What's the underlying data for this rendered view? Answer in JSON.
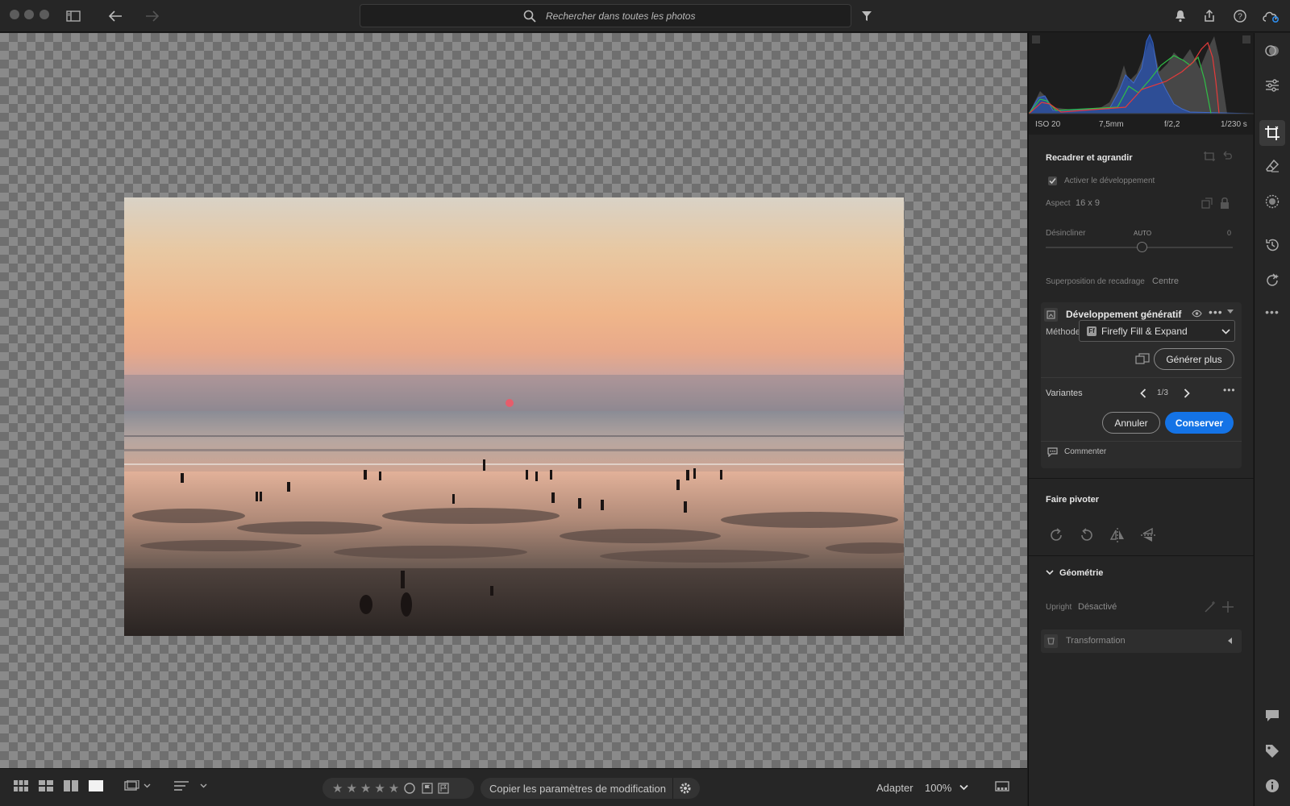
{
  "topbar": {
    "search_placeholder": "Rechercher dans toutes les photos"
  },
  "histogram": {
    "iso": "ISO 20",
    "focal": "7,5mm",
    "aperture": "f/2,2",
    "shutter": "1/230 s"
  },
  "crop": {
    "title": "Recadrer et agrandir",
    "enable_expand_label": "Activer le développement",
    "enable_expand_checked": true,
    "aspect_label": "Aspect",
    "aspect_value": "16 x 9",
    "straighten_label": "Désincliner",
    "straighten_auto": "AUTO",
    "straighten_value": "0",
    "overlay_label": "Superposition de recadrage",
    "overlay_value": "Centre"
  },
  "generative": {
    "title": "Développement génératif",
    "method_label": "Méthode",
    "method_value": "Firefly Fill & Expand",
    "generate_more": "Générer plus",
    "variants_label": "Variantes",
    "variants_counter": "1/3",
    "cancel": "Annuler",
    "keep": "Conserver",
    "comment": "Commenter"
  },
  "rotate": {
    "title": "Faire pivoter"
  },
  "geometry": {
    "title": "Géométrie",
    "upright_label": "Upright",
    "upright_value": "Désactivé",
    "transform_label": "Transformation"
  },
  "bottombar": {
    "copy_settings": "Copier les paramètres de modification",
    "fit_label": "Adapter",
    "zoom": "100%"
  },
  "colors": {
    "accent": "#1473e6"
  }
}
